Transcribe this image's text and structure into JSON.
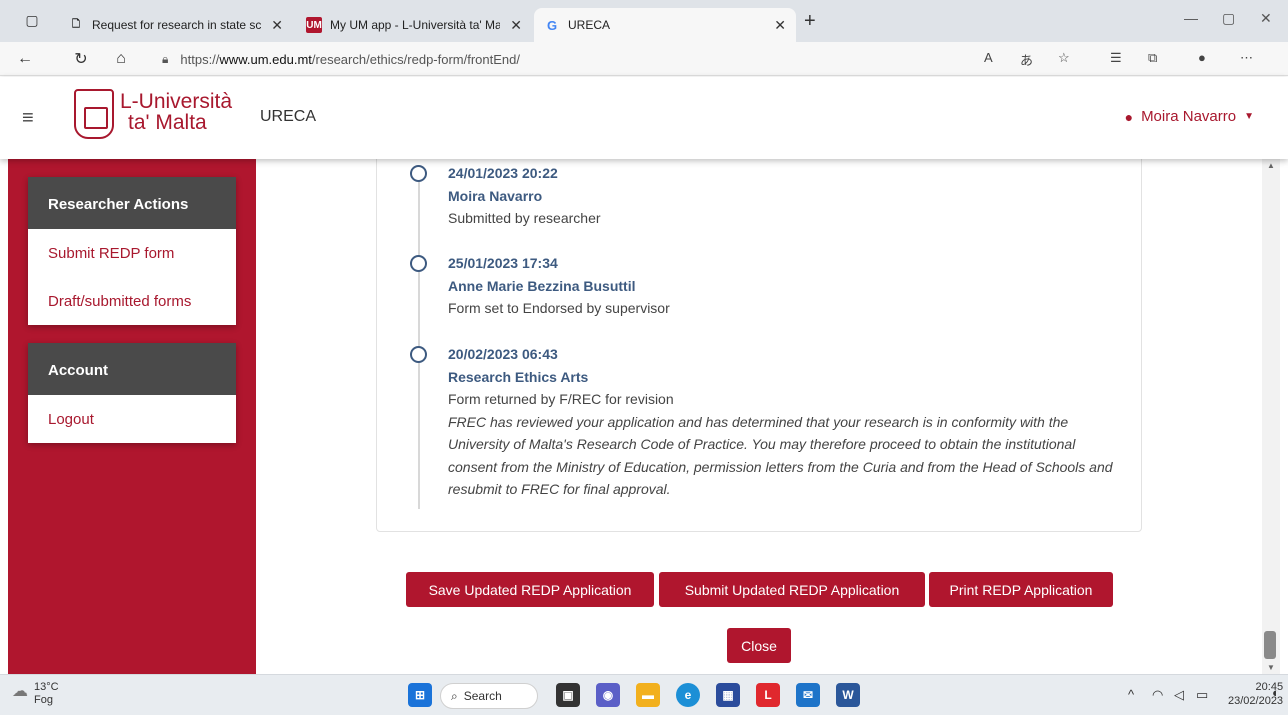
{
  "browser": {
    "tabs": [
      {
        "title": "Request for research in state scho",
        "favicon": "page-icon"
      },
      {
        "title": "My UM app - L-Università ta' Malta",
        "favicon": "UM"
      },
      {
        "title": "URECA",
        "favicon": "G"
      }
    ],
    "url_prefix": "https://",
    "url_domain": "www.um.edu.mt",
    "url_path": "/research/ethics/redp-form/frontEnd/"
  },
  "header": {
    "logo_line1": "L-Università",
    "logo_line2": "ta' Malta",
    "app_name": "URECA",
    "user_name": "Moira Navarro"
  },
  "sidebar": {
    "researcher_actions": {
      "title": "Researcher Actions",
      "items": [
        "Submit REDP form",
        "Draft/submitted forms"
      ]
    },
    "account": {
      "title": "Account",
      "items": [
        "Logout"
      ]
    }
  },
  "timeline": [
    {
      "date": "24/01/2023 20:22",
      "name": "Moira Navarro",
      "desc": "Submitted by researcher",
      "note": ""
    },
    {
      "date": "25/01/2023 17:34",
      "name": "Anne Marie Bezzina Busuttil",
      "desc": "Form set to Endorsed by supervisor",
      "note": ""
    },
    {
      "date": "20/02/2023 06:43",
      "name": "Research Ethics Arts",
      "desc": "Form returned by F/REC for revision",
      "note": "FREC has reviewed your application and has determined that your research is in conformity with the University of Malta's Research Code of Practice. You may therefore proceed to obtain the institutional consent from the Ministry of Education, permission letters from the Curia and from the Head of Schools and resubmit to FREC for final approval."
    }
  ],
  "buttons": {
    "save": "Save Updated REDP Application",
    "submit": "Submit Updated REDP Application",
    "print": "Print REDP Application",
    "close": "Close"
  },
  "taskbar": {
    "temperature": "13°C",
    "weather": "Fog",
    "search": "Search",
    "time": "20:45",
    "date": "23/02/2023"
  },
  "colors": {
    "brand": "#b0162e",
    "timeline_text": "#3d5a80"
  }
}
